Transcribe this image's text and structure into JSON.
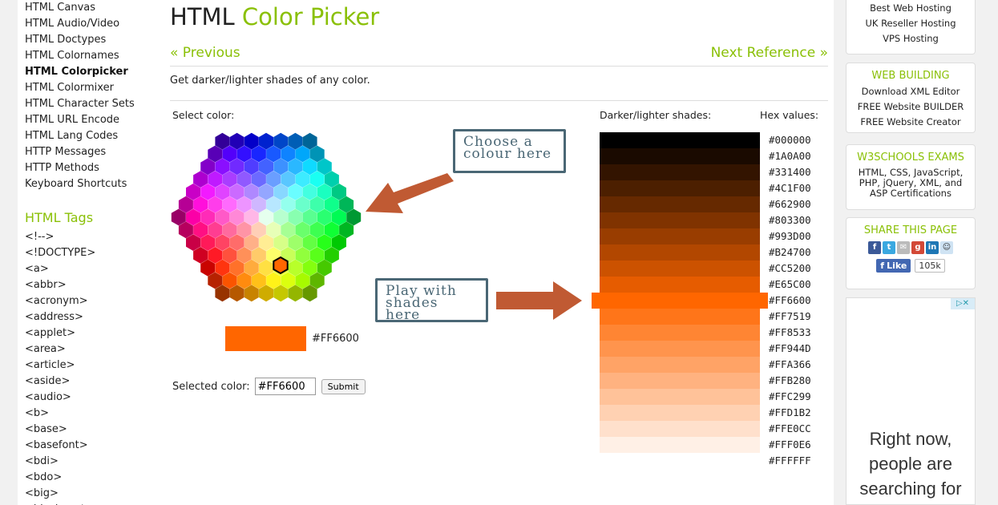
{
  "leftnav": {
    "items_top": [
      {
        "label": "HTML Canvas",
        "active": false
      },
      {
        "label": "HTML Audio/Video",
        "active": false
      },
      {
        "label": "HTML Doctypes",
        "active": false
      },
      {
        "label": "HTML Colornames",
        "active": false
      },
      {
        "label": "HTML Colorpicker",
        "active": true
      },
      {
        "label": "HTML Colormixer",
        "active": false
      },
      {
        "label": "HTML Character Sets",
        "active": false
      },
      {
        "label": "HTML URL Encode",
        "active": false
      },
      {
        "label": "HTML Lang Codes",
        "active": false
      },
      {
        "label": "HTTP Messages",
        "active": false
      },
      {
        "label": "HTTP Methods",
        "active": false
      },
      {
        "label": "Keyboard Shortcuts",
        "active": false
      }
    ],
    "tags_heading": "HTML Tags",
    "tags": [
      "<!-->",
      "<!DOCTYPE>",
      "<a>",
      "<abbr>",
      "<acronym>",
      "<address>",
      "<applet>",
      "<area>",
      "<article>",
      "<aside>",
      "<audio>",
      "<b>",
      "<base>",
      "<basefont>",
      "<bdi>",
      "<bdo>",
      "<big>",
      "<blockquote>"
    ]
  },
  "main": {
    "title_prefix": "HTML",
    "title_accent": "Color Picker",
    "prev_label": "« Previous",
    "next_label": "Next Reference »",
    "intro": "Get darker/lighter shades of any color.",
    "select_color_label": "Select color:",
    "shades_label": "Darker/lighter shades:",
    "hex_values_label": "Hex values:",
    "callout_choose_line1": "Choose a",
    "callout_choose_line2": "colour here",
    "callout_play_line1": "Play with",
    "callout_play_line2": "shades here",
    "selected_swatch_hex": "#FF6600",
    "selected_color_label": "Selected color:",
    "selected_color_value": "#FF6600",
    "submit_label": "Submit",
    "accent_color": "#8ac007",
    "arrow_color": "#c05a33",
    "shades": [
      "#000000",
      "#1A0A00",
      "#331400",
      "#4C1F00",
      "#662900",
      "#803300",
      "#993D00",
      "#B24700",
      "#CC5200",
      "#E65C00",
      "#FF6600",
      "#FF7519",
      "#FF8533",
      "#FF944D",
      "#FFA366",
      "#FFB280",
      "#FFC299",
      "#FFD1B2",
      "#FFE0CC",
      "#FFF0E6",
      "#FFFFFF"
    ],
    "selected_shade_index": 10
  },
  "right": {
    "hosting": [
      "Best Web Hosting",
      "UK Reseller Hosting",
      "VPS Hosting"
    ],
    "web_building_head": "WEB BUILDING",
    "web_building": [
      "Download XML Editor",
      "FREE Website BUILDER",
      "FREE Website Creator"
    ],
    "exams_head": "W3SCHOOLS EXAMS",
    "exams_text": "HTML, CSS, JavaScript, PHP, jQuery, XML, and ASP Certifications",
    "share_head": "SHARE THIS PAGE",
    "like_label": "Like",
    "like_count": "105k",
    "ad_line1": "Right now,",
    "ad_line2": "people are",
    "ad_line3": "searching for"
  }
}
